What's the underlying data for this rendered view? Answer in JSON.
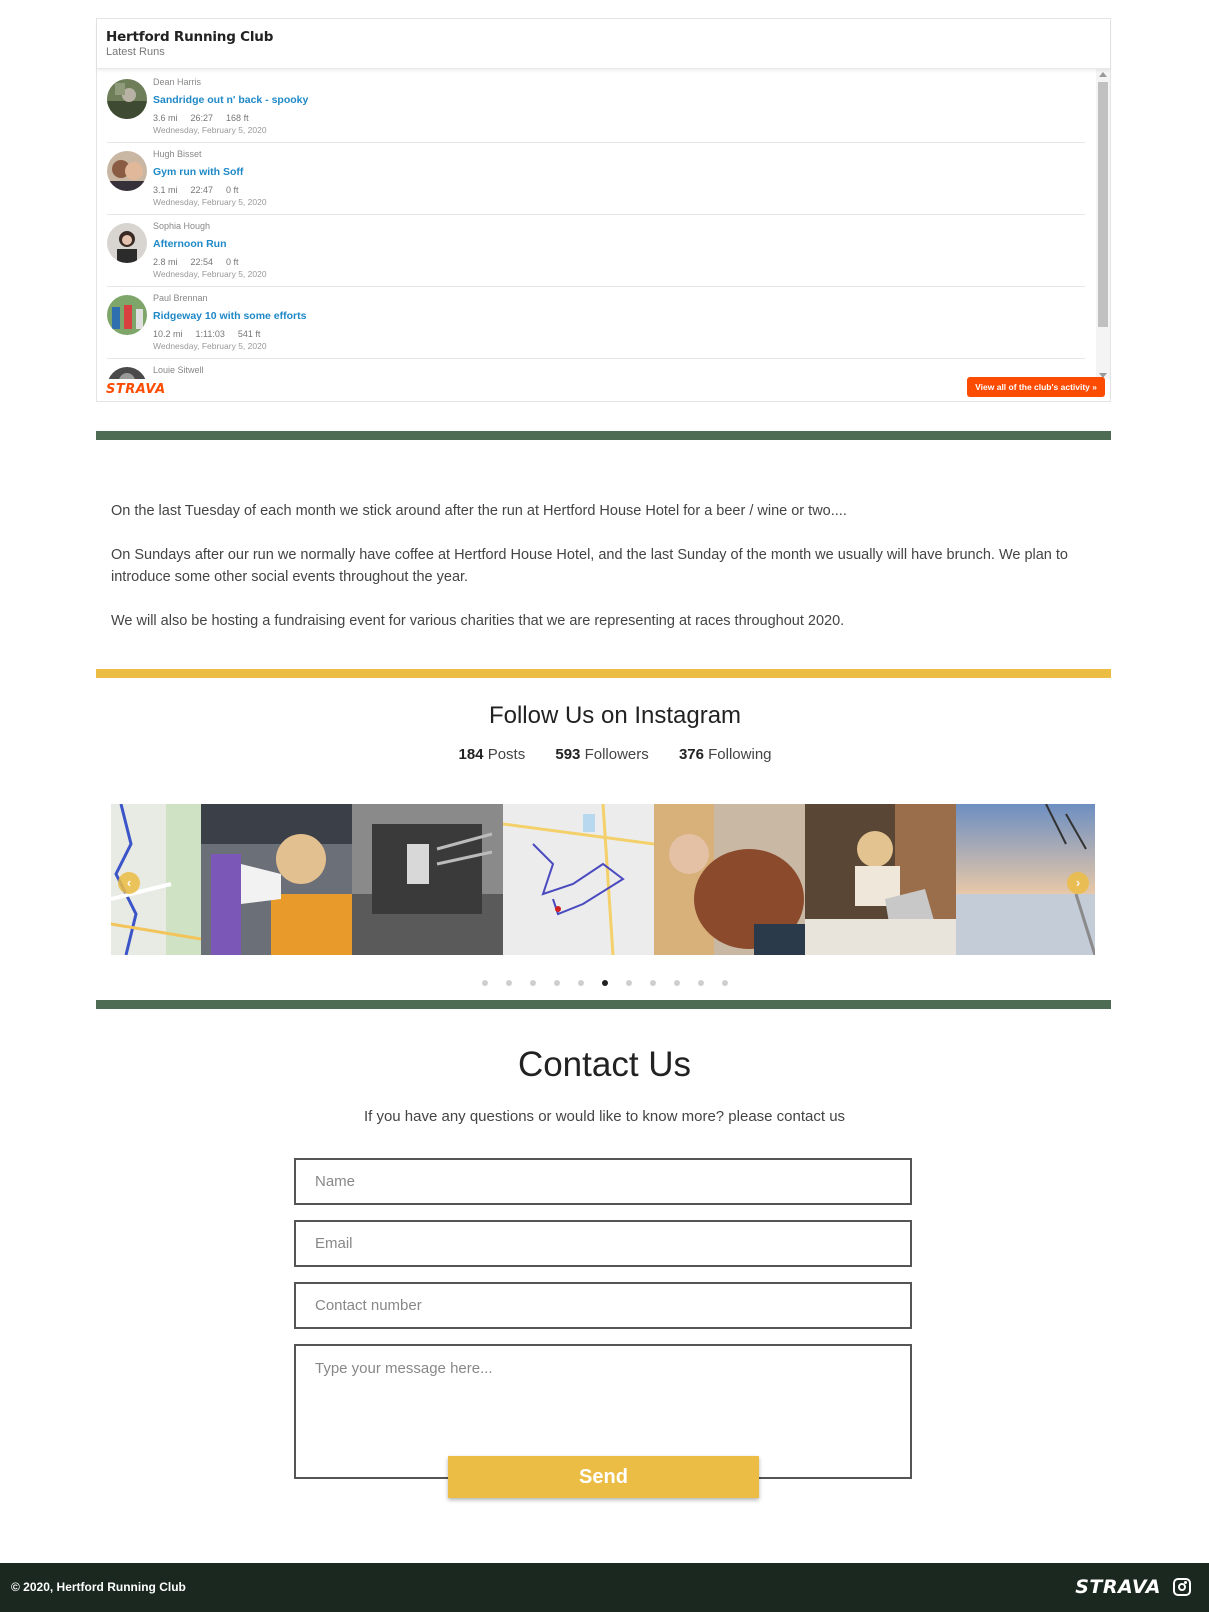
{
  "strava": {
    "club_name": "Hertford Running Club",
    "subtitle": "Latest Runs",
    "logo_text": "STRAVA",
    "view_all": "View all of the club's activity »",
    "runs": [
      {
        "athlete": "Dean Harris",
        "activity": "Sandridge out n' back - spooky",
        "distance": "3.6 mi",
        "time": "26:27",
        "elevation": "168 ft",
        "date": "Wednesday, February 5, 2020"
      },
      {
        "athlete": "Hugh Bisset",
        "activity": "Gym run with Soff",
        "distance": "3.1 mi",
        "time": "22:47",
        "elevation": "0 ft",
        "date": "Wednesday, February 5, 2020"
      },
      {
        "athlete": "Sophia Hough",
        "activity": "Afternoon Run",
        "distance": "2.8 mi",
        "time": "22:54",
        "elevation": "0 ft",
        "date": "Wednesday, February 5, 2020"
      },
      {
        "athlete": "Paul Brennan",
        "activity": "Ridgeway 10 with some efforts",
        "distance": "10.2 mi",
        "time": "1:11:03",
        "elevation": "541 ft",
        "date": "Wednesday, February 5, 2020"
      },
      {
        "athlete": "Louie Sitwell",
        "activity": "",
        "distance": "",
        "time": "",
        "elevation": "",
        "date": ""
      }
    ]
  },
  "social": {
    "paragraphs": [
      "On the last Tuesday of each month we stick around after the run at Hertford House Hotel for a beer / wine or two....",
      "On Sundays after our run we normally have coffee at Hertford House Hotel, and the last Sunday of the month we usually will have brunch. We plan to introduce some other social events throughout the year.",
      "We will also be hosting a fundraising event for various charities that we are representing at races throughout 2020."
    ]
  },
  "instagram": {
    "title": "Follow Us on Instagram",
    "posts_count": "184",
    "posts_label": "Posts",
    "followers_count": "593",
    "followers_label": "Followers",
    "following_count": "376",
    "following_label": "Following",
    "dots_total": 11,
    "active_dot": 6,
    "prev_icon": "chevron-left-icon",
    "next_icon": "chevron-right-icon"
  },
  "contact": {
    "title": "Contact Us",
    "subtitle": "If you have any questions or would like to know more? please contact us",
    "name_placeholder": "Name",
    "email_placeholder": "Email",
    "phone_placeholder": "Contact number",
    "message_placeholder": "Type your message here...",
    "send_label": "Send"
  },
  "footer": {
    "copyright": "© 2020, Hertford Running Club",
    "strava_text": "STRAVA",
    "instagram_icon": "instagram-icon"
  },
  "colors": {
    "green": "#4e6b53",
    "yellow": "#ecbd44",
    "strava_orange": "#fc4c02",
    "footer_bg": "#1b2820",
    "link_blue": "#1e88c7"
  }
}
